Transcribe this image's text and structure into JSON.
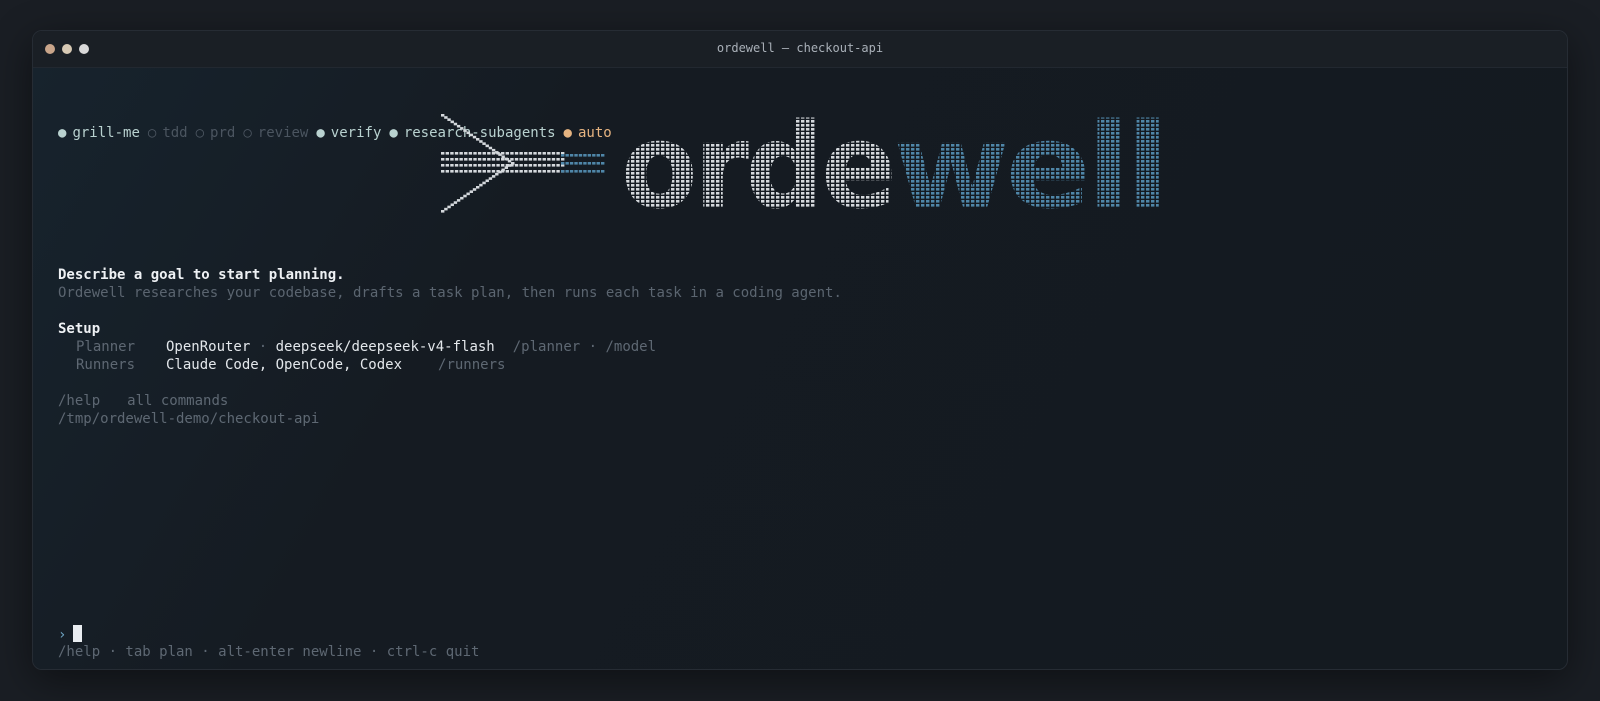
{
  "window": {
    "title": "ordewell — checkout-api",
    "traffic_colors": [
      "#c9a58a",
      "#d7c9b4",
      "#d9d9d9"
    ]
  },
  "skills": [
    {
      "name": "grill-me",
      "state": "on"
    },
    {
      "name": "tdd",
      "state": "off"
    },
    {
      "name": "prd",
      "state": "off"
    },
    {
      "name": "review",
      "state": "off"
    },
    {
      "name": "verify",
      "state": "on"
    },
    {
      "name": "research-subagents",
      "state": "on"
    },
    {
      "name": "auto",
      "state": "accent"
    }
  ],
  "skill_glyphs": {
    "on": "●",
    "off": "○",
    "accent": "●"
  },
  "logo": {
    "word_gray": "orde",
    "word_blue": "well",
    "gray_color": "#d4d8dc",
    "blue_color": "#4f86a8"
  },
  "intro": {
    "heading": "Describe a goal to start planning.",
    "subtitle": "Ordewell researches your codebase, drafts a task plan, then runs each task in a coding agent."
  },
  "setup": {
    "heading": "Setup",
    "planner": {
      "label": "Planner",
      "provider": "OpenRouter",
      "sep": " · ",
      "model": "deepseek/deepseek-v4-flash",
      "cmds": "/planner · /model"
    },
    "runners": {
      "label": "Runners",
      "value": "Claude Code, OpenCode, Codex",
      "cmds": "/runners"
    }
  },
  "help": {
    "command": "/help",
    "desc": "all commands",
    "path": "/tmp/ordewell-demo/checkout-api"
  },
  "prompt": {
    "arrow": "›",
    "hints": "/help · tab plan · alt-enter newline · ctrl-c quit"
  }
}
